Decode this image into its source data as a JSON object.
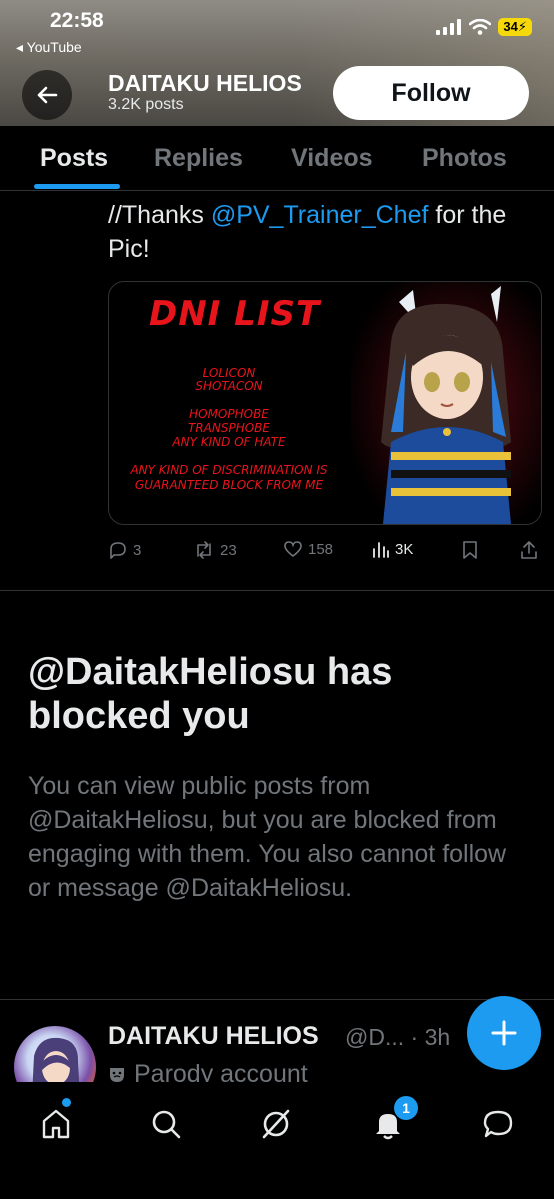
{
  "status_bar": {
    "time": "22:58",
    "back_app": "YouTube",
    "battery": "34"
  },
  "header": {
    "name": "DAITAKU HELIOS",
    "posts": "3.2K posts",
    "follow_label": "Follow"
  },
  "tabs": [
    {
      "label": "Posts",
      "active": true
    },
    {
      "label": "Replies",
      "active": false
    },
    {
      "label": "Videos",
      "active": false
    },
    {
      "label": "Photos",
      "active": false
    }
  ],
  "post": {
    "text_prefix": "//Thanks ",
    "mention": "@PV_Trainer_Chef",
    "text_suffix": " for the Pic!",
    "image": {
      "title": "DNI LIST",
      "lines": [
        "LOLICON",
        "SHOTACON",
        "HOMOPHOBE",
        "TRANSPHOBE",
        "ANY KIND OF HATE",
        "ANY KIND OF DISCRIMINATION IS",
        "GUARANTEED BLOCK FROM ME"
      ]
    },
    "stats": {
      "replies": "3",
      "reposts": "23",
      "likes": "158",
      "views": "3K"
    }
  },
  "blocked": {
    "title": "@DaitakHeliosu has blocked you",
    "body": "You can view public posts from @DaitakHeliosu, but you are blocked from engaging with them. You also cannot follow or message @DaitakHeliosu."
  },
  "next_post": {
    "name": "DAITAKU HELIOS",
    "handle": "@D... · 3h",
    "label": "Parody account"
  },
  "nav": {
    "notification_count": "1"
  },
  "colors": {
    "accent": "#1d9bf0",
    "dni_red": "#e8141c",
    "muted": "#71767b"
  }
}
